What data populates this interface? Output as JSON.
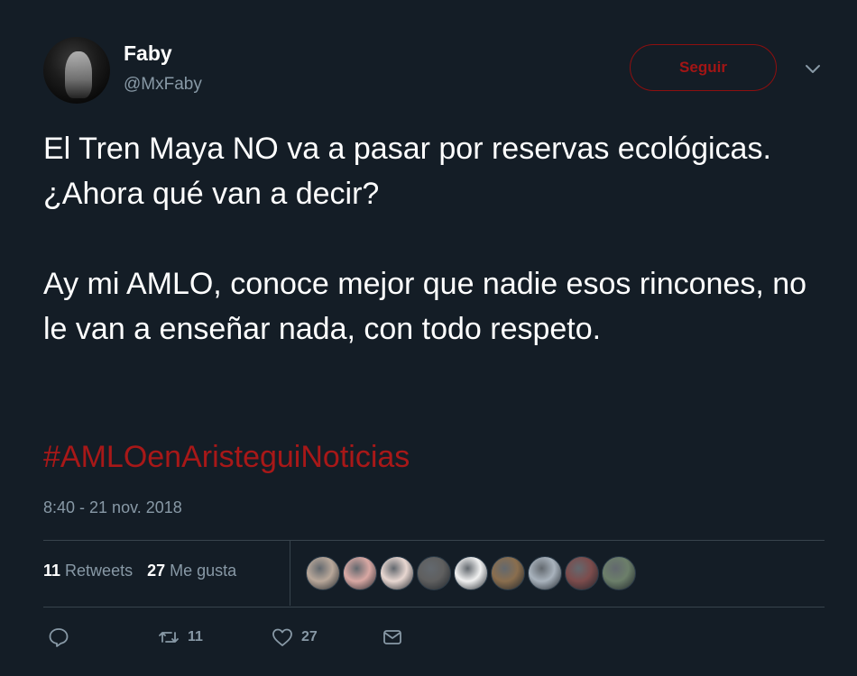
{
  "user": {
    "display_name": "Faby",
    "handle": "@MxFaby"
  },
  "follow_button": {
    "label": "Seguir"
  },
  "tweet": {
    "paragraph_1": "El Tren Maya NO va a pasar por reservas ecológicas. ¿Ahora qué van a decir?",
    "paragraph_2": "Ay mi AMLO, conoce mejor que nadie esos rincones, no le van a enseñar nada, con todo respeto.",
    "hashtag": "#AMLOenAristeguiNoticias",
    "timestamp": "8:40 - 21 nov. 2018"
  },
  "stats": {
    "retweets_count": "11",
    "retweets_label": "Retweets",
    "likes_count": "27",
    "likes_label": "Me gusta"
  },
  "likers": [
    {
      "name": "liker-avatar-1",
      "color": "#b9a89a"
    },
    {
      "name": "liker-avatar-2",
      "color": "#d9a8a3"
    },
    {
      "name": "liker-avatar-3",
      "color": "#e8d7d1"
    },
    {
      "name": "liker-avatar-4",
      "color": "#5f5f5f"
    },
    {
      "name": "liker-avatar-5",
      "color": "#f1f1f1"
    },
    {
      "name": "liker-avatar-6",
      "color": "#8a6e4e"
    },
    {
      "name": "liker-avatar-7",
      "color": "#a9b3bd"
    },
    {
      "name": "liker-avatar-8",
      "color": "#7d4c4c"
    },
    {
      "name": "liker-avatar-9",
      "color": "#6c7f6a"
    }
  ],
  "actions": {
    "reply_icon": "reply-icon",
    "retweet_icon": "retweet-icon",
    "retweet_count": "11",
    "like_icon": "heart-icon",
    "like_count": "27",
    "dm_icon": "envelope-icon"
  },
  "colors": {
    "background": "#141d26",
    "accent_red": "#a81818",
    "muted": "#8899a6"
  }
}
